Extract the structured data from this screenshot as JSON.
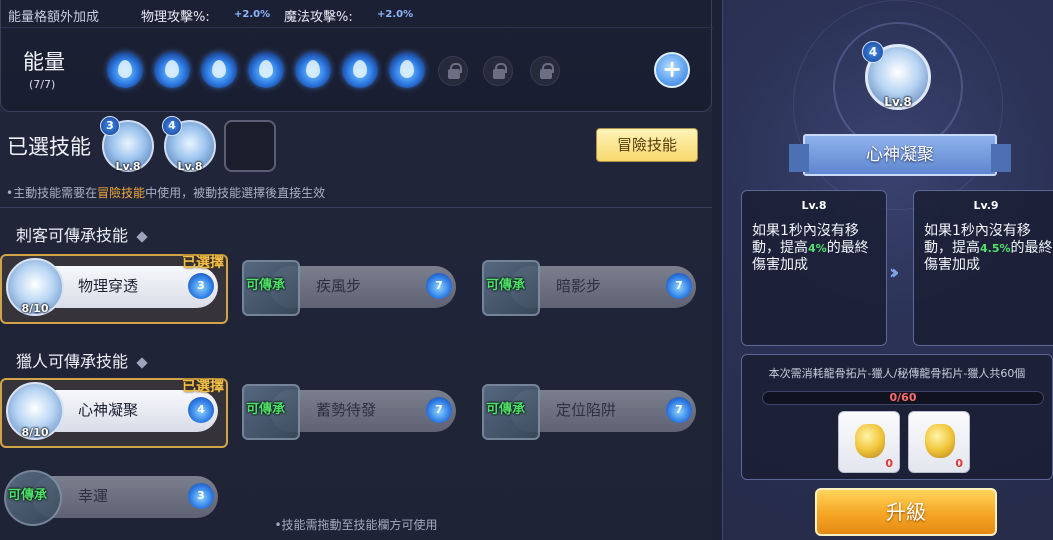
{
  "bonus": {
    "title": "能量格額外加成",
    "phys_label": "物理攻擊%:",
    "phys_value": "+2.0%",
    "magic_label": "魔法攻擊%:",
    "magic_value": "+2.0%"
  },
  "energy": {
    "title": "能量",
    "count": "(7/7)",
    "filled": 7,
    "locked": 3,
    "add_label": "+"
  },
  "selected": {
    "title": "已選技能",
    "slots": [
      {
        "badge": "3",
        "level": "Lv.8",
        "icon": "piercing-arrows-icon"
      },
      {
        "badge": "4",
        "level": "Lv.8",
        "icon": "meditation-icon"
      }
    ],
    "adventure_button": "冒險技能",
    "hint_pre": "•主動技能需要在",
    "hint_hl": "冒險技能",
    "hint_post": "中使用，被動技能選擇後直接生效"
  },
  "assassin": {
    "title": "刺客可傳承技能",
    "skills": [
      {
        "name": "物理穿透",
        "cost": "3",
        "progress": "8/10",
        "tag": "已選擇"
      },
      {
        "name": "疾風步",
        "cost": "7",
        "tag": "可傳承"
      },
      {
        "name": "暗影步",
        "cost": "7",
        "tag": "可傳承"
      }
    ]
  },
  "hunter": {
    "title": "獵人可傳承技能",
    "skills": [
      {
        "name": "心神凝聚",
        "cost": "4",
        "progress": "8/10",
        "tag": "已選擇"
      },
      {
        "name": "蓄勢待發",
        "cost": "7",
        "tag": "可傳承"
      },
      {
        "name": "定位陷阱",
        "cost": "7",
        "tag": "可傳承"
      },
      {
        "name": "幸運",
        "cost": "3",
        "tag": "可傳承"
      }
    ]
  },
  "bottom_hint": "•技能需拖動至技能欄方可使用",
  "detail": {
    "badge": "4",
    "level": "Lv.8",
    "name": "心神凝聚",
    "current": {
      "level": "Lv.8",
      "desc_pre": "如果1秒內沒有移動，提高",
      "value": "4%",
      "desc_post": "的最終傷害加成"
    },
    "next": {
      "level": "Lv.9",
      "desc_pre": "如果1秒內沒有移動，提高",
      "value": "4.5%",
      "desc_post": "的最終傷害加成"
    },
    "arrow": "››",
    "material_text": "本次需消耗龍骨拓片-獵人/秘傳龍骨拓片-獵人共60個",
    "progress_text": "0/60",
    "progress_fraction": 0,
    "items": [
      {
        "icon": "dragon-bone-rubbing-icon",
        "count": "0"
      },
      {
        "icon": "secret-dragon-bone-rubbing-icon",
        "count": "0"
      }
    ],
    "upgrade_label": "升級"
  },
  "colors": {
    "accent_gold": "#f4c04a",
    "inherit_green": "#4fe26a",
    "value_blue": "#8fb7ff",
    "progress_red": "#ff6b6b"
  }
}
